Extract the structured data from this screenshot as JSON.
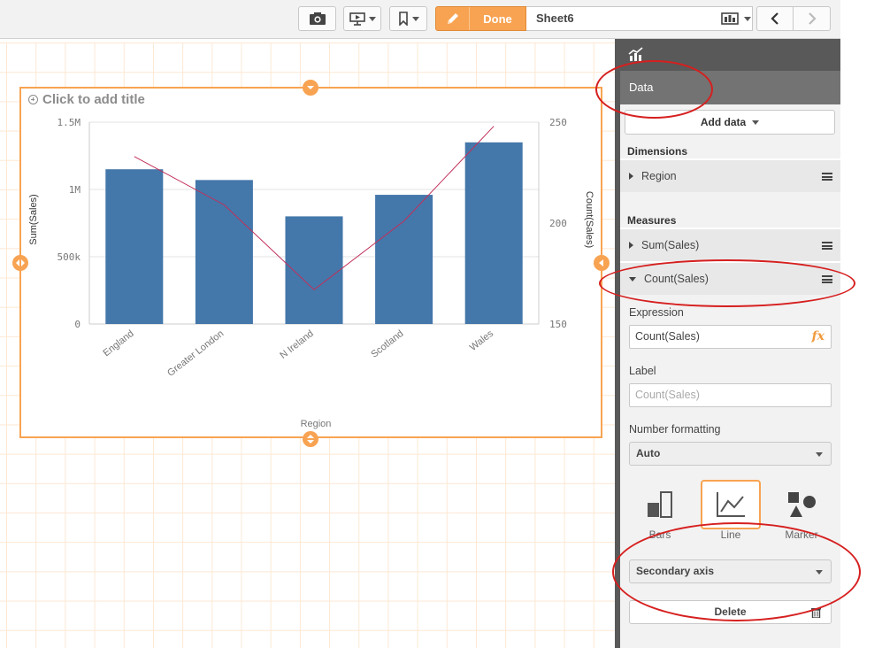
{
  "toolbar": {
    "done_label": "Done",
    "sheet_name": "Sheet6",
    "icons": [
      "camera-icon",
      "present-icon",
      "bookmark-icon",
      "pencil-icon",
      "sheets-icon",
      "prev-icon",
      "next-icon"
    ]
  },
  "chart": {
    "title_placeholder": "Click to add title"
  },
  "chart_data": {
    "type": "bar",
    "categories": [
      "England",
      "Greater London",
      "N Ireland",
      "Scotland",
      "Wales"
    ],
    "series": [
      {
        "name": "Sum(Sales)",
        "type": "bar",
        "axis": "left",
        "values": [
          1150000,
          1070000,
          800000,
          960000,
          1350000
        ]
      },
      {
        "name": "Count(Sales)",
        "type": "line",
        "axis": "right",
        "values": [
          233,
          209,
          167,
          201,
          248
        ]
      }
    ],
    "xlabel": "Region",
    "ylabel": "Sum(Sales)",
    "y2label": "Count(Sales)",
    "ylim": [
      0,
      1500000
    ],
    "y2lim": [
      150,
      250
    ],
    "yticks": [
      {
        "v": 0,
        "label": "0"
      },
      {
        "v": 500000,
        "label": "500k"
      },
      {
        "v": 1000000,
        "label": "1M"
      },
      {
        "v": 1500000,
        "label": "1.5M"
      }
    ],
    "y2ticks": [
      {
        "v": 150,
        "label": "150"
      },
      {
        "v": 200,
        "label": "200"
      },
      {
        "v": 250,
        "label": "250"
      }
    ],
    "grid": true,
    "colors": {
      "bar": "#4477aa",
      "line": "#c2305a"
    }
  },
  "panel": {
    "tab_label": "Data",
    "add_data_label": "Add data",
    "dimensions_heading": "Dimensions",
    "dimension_item": "Region",
    "measures_heading": "Measures",
    "measure_items": [
      "Sum(Sales)",
      "Count(Sales)"
    ],
    "expression_label": "Expression",
    "expression_value": "Count(Sales)",
    "label_label": "Label",
    "label_placeholder": "Count(Sales)",
    "number_format_label": "Number formatting",
    "number_format_value": "Auto",
    "viz_types": [
      "Bars",
      "Line",
      "Marker"
    ],
    "axis_value": "Secondary axis",
    "delete_label": "Delete"
  },
  "colors": {
    "accent": "#f8a352",
    "annotation": "#d61f1f",
    "panel_dark": "#595959"
  }
}
